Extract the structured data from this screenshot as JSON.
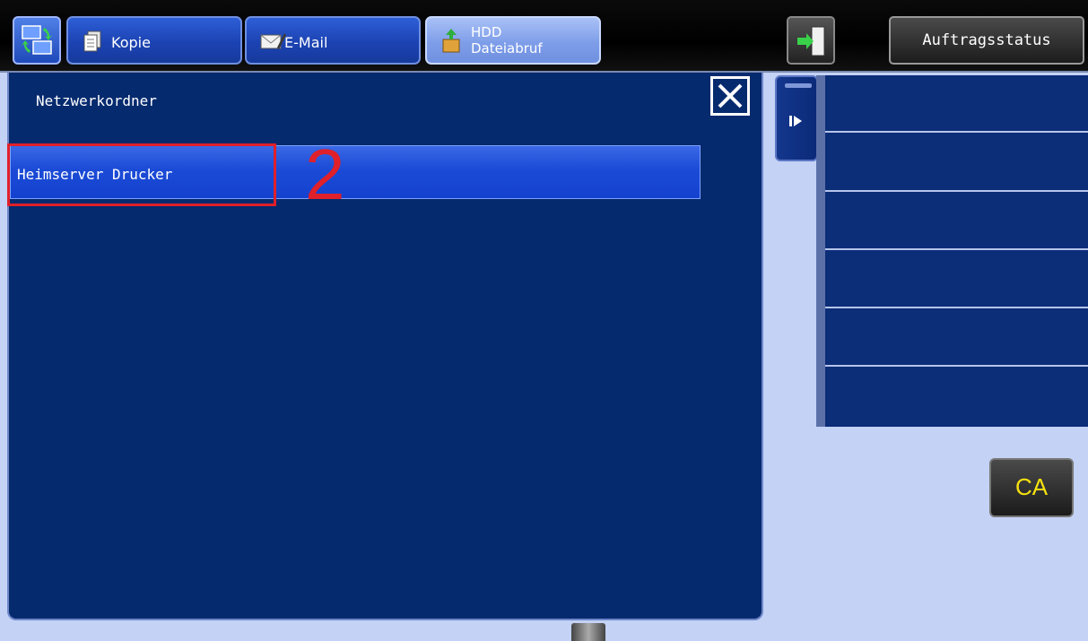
{
  "header": {
    "tabs": [
      {
        "label": "Kopie",
        "icon": "copy-icon"
      },
      {
        "label": "E-Mail",
        "icon": "email-icon"
      },
      {
        "label_line1": "HDD",
        "label_line2": "Dateiabruf",
        "icon": "hdd-retrieve-icon",
        "active": true
      }
    ],
    "status_button": "Auftragsstatus",
    "home_icon": "mode-switch-icon",
    "logout_icon": "logout-door-icon"
  },
  "panel": {
    "title": "Netzwerkordner",
    "close_icon": "close-x-icon",
    "folders": [
      {
        "label": "Heimserver Drucker"
      }
    ]
  },
  "annotation": {
    "step_number": "2",
    "color": "#e0202a"
  },
  "sidebar": {
    "expand_icon": "expand-arrow-icon",
    "rows": 6
  },
  "ca_button": "CA",
  "colors": {
    "panel_bg": "#052a6e",
    "page_bg": "#c3d2f5",
    "accent": "#1b4bd6",
    "ca_text": "#f5e10f"
  }
}
